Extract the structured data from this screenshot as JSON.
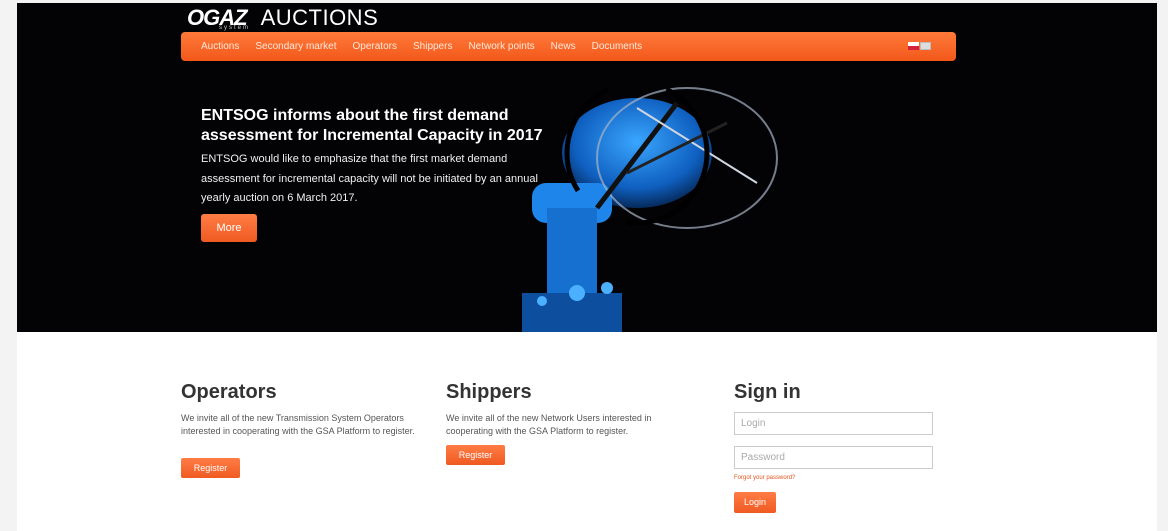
{
  "brand": {
    "logo_mark": "OGAZ",
    "logo_sub": "system",
    "title": "AUCTIONS"
  },
  "nav": {
    "items": [
      "Auctions",
      "Secondary market",
      "Operators",
      "Shippers",
      "Network points",
      "News",
      "Documents"
    ]
  },
  "hero": {
    "headline": "ENTSOG informs about the first demand assessment for Incremental Capacity in 2017",
    "body": "ENTSOG would like to emphasize that the first market demand assessment for incremental capacity will not be initiated by an annual yearly auction on 6 March 2017.",
    "more_label": "More"
  },
  "operators": {
    "title": "Operators",
    "text": "We invite all of the new Transmission System Operators interested in cooperating with the GSA Platform to register.",
    "button": "Register"
  },
  "shippers": {
    "title": "Shippers",
    "text": "We invite all of the new Network Users interested in cooperating with the GSA Platform to register.",
    "button": "Register"
  },
  "signin": {
    "title": "Sign in",
    "login_placeholder": "Login",
    "password_placeholder": "Password",
    "forgot": "Forgot your password?",
    "button": "Login"
  },
  "colors": {
    "accent": "#f2581a",
    "hero_bg": "#030306",
    "robot_blue": "#1a7fe0"
  }
}
